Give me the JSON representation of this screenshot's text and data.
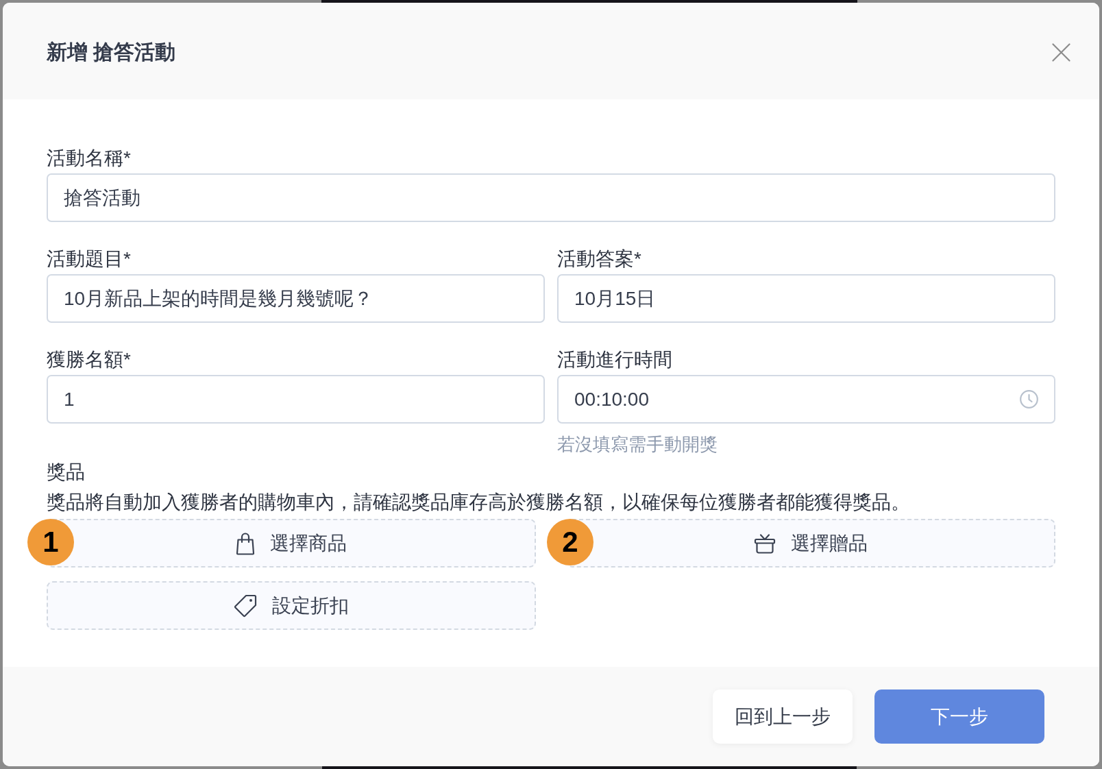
{
  "dialog": {
    "title": "新增 搶答活動"
  },
  "form_rows": [
    [
      {
        "label": "活動名稱*",
        "value": "搶答活動",
        "kind": "text"
      }
    ],
    [
      {
        "label": "活動題目*",
        "value": "10月新品上架的時間是幾月幾號呢？",
        "kind": "text"
      },
      {
        "label": "活動答案*",
        "value": "10月15日",
        "kind": "text"
      }
    ],
    [
      {
        "label": "獲勝名額*",
        "value": "1",
        "kind": "text"
      },
      {
        "label": "活動進行時間",
        "value": "00:10:00",
        "kind": "time",
        "hint": "若沒填寫需手動開獎"
      }
    ]
  ],
  "prizes": {
    "label": "獎品",
    "description": "獎品將自動加入獲勝者的購物車內，請確認獎品庫存高於獲勝名額，以確保每位獲勝者都能獲得獎品。",
    "options": [
      {
        "label": "選擇商品",
        "kind": "product",
        "badge": "1"
      },
      {
        "label": "選擇贈品",
        "kind": "gift",
        "badge": "2"
      },
      {
        "label": "設定折扣",
        "kind": "discount"
      }
    ]
  },
  "footer": {
    "buttons": [
      {
        "label": "回到上一步",
        "kind": "secondary"
      },
      {
        "label": "下一步",
        "kind": "primary"
      }
    ]
  }
}
